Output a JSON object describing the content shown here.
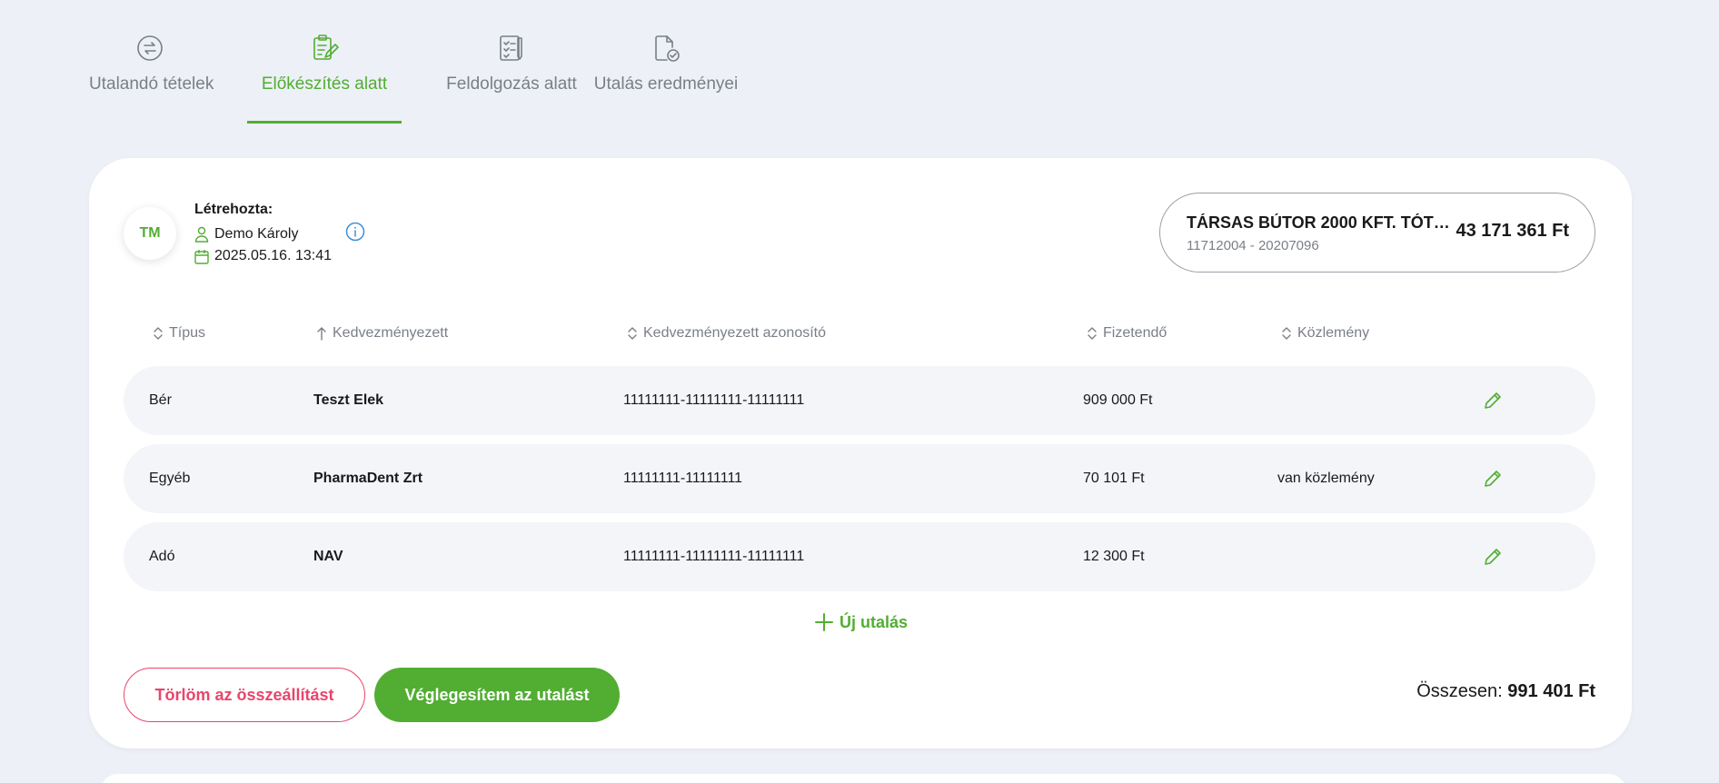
{
  "tabs": [
    {
      "label": "Utalandó tételek",
      "icon": "transfer-icon",
      "active": false
    },
    {
      "label": "Előkészítés alatt",
      "icon": "clipboard-edit-icon",
      "active": true
    },
    {
      "label": "Feldolgozás alatt",
      "icon": "checklist-icon",
      "active": false
    },
    {
      "label": "Utalás eredményei",
      "icon": "document-check-icon",
      "active": false
    }
  ],
  "creator": {
    "initials": "TM",
    "title": "Létrehozta:",
    "name": "Demo Károly",
    "datetime": "2025.05.16. 13:41"
  },
  "account": {
    "name": "TÁRSAS BÚTOR 2000 KFT. TÓTH...",
    "number": "11712004 - 20207096",
    "amount": "43 171 361 Ft"
  },
  "table": {
    "headers": [
      "Típus",
      "Kedvezményezett",
      "Kedvezményezett azonosító",
      "Fizetendő",
      "Közlemény"
    ],
    "rows": [
      {
        "type": "Bér",
        "beneficiary": "Teszt Elek",
        "id": "11111111-11111111-11111111",
        "amount": "909 000 Ft",
        "note": ""
      },
      {
        "type": "Egyéb",
        "beneficiary": "PharmaDent Zrt",
        "id": "11111111-11111111",
        "amount": "70 101 Ft",
        "note": "van közlemény"
      },
      {
        "type": "Adó",
        "beneficiary": "NAV",
        "id": "11111111-11111111-11111111",
        "amount": "12 300 Ft",
        "note": ""
      }
    ]
  },
  "actions": {
    "new_transfer": "Új utalás",
    "delete": "Törlöm az összeállítást",
    "finalize": "Véglegesítem az utalást"
  },
  "total": {
    "label": "Összesen:",
    "value": "991 401 Ft"
  },
  "colors": {
    "accent": "#52ad33",
    "danger": "#e8466a",
    "background": "#edf0f6"
  }
}
